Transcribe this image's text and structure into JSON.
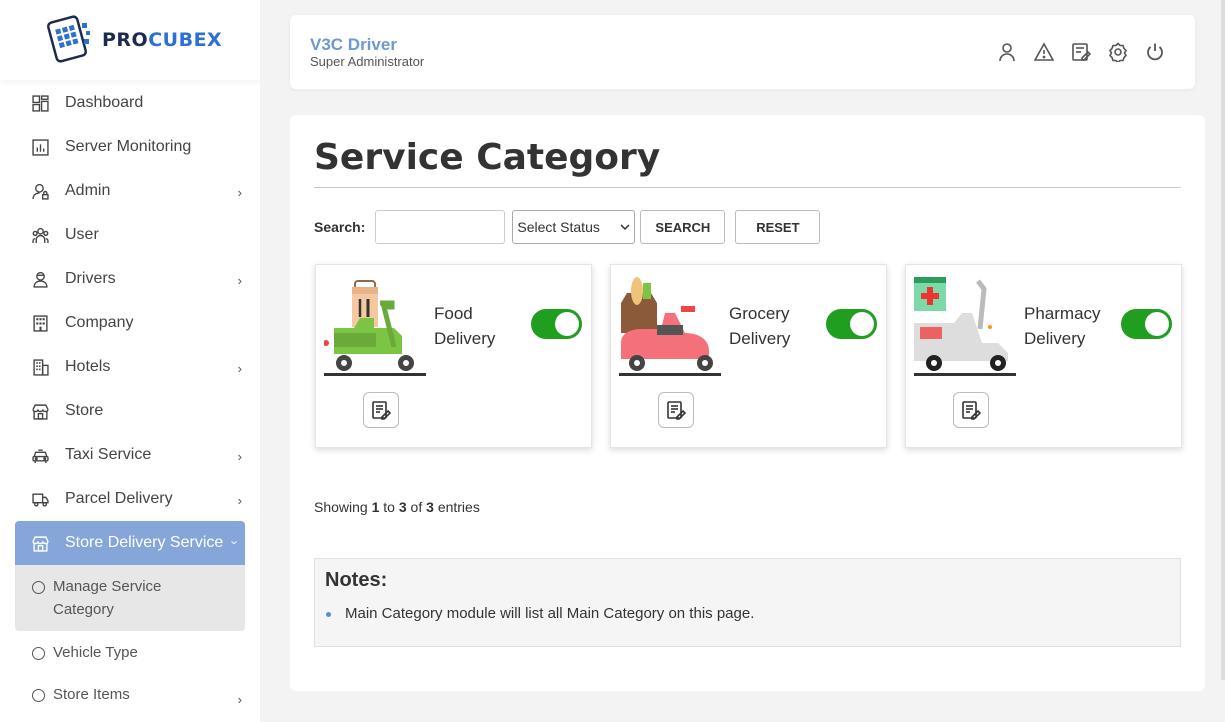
{
  "brand": {
    "logo_pro": "PRO",
    "logo_cubex": "CUBEX"
  },
  "sidebar": {
    "items": [
      {
        "label": "Dashboard",
        "icon": "dashboard-icon"
      },
      {
        "label": "Server Monitoring",
        "icon": "chart-icon"
      },
      {
        "label": "Admin",
        "icon": "admin-icon",
        "expandable": true
      },
      {
        "label": "User",
        "icon": "users-icon"
      },
      {
        "label": "Drivers",
        "icon": "driver-icon",
        "expandable": true
      },
      {
        "label": "Company",
        "icon": "building-icon"
      },
      {
        "label": "Hotels",
        "icon": "hotel-icon",
        "expandable": true
      },
      {
        "label": "Store",
        "icon": "store-icon"
      },
      {
        "label": "Taxi Service",
        "icon": "taxi-icon",
        "expandable": true
      },
      {
        "label": "Parcel Delivery",
        "icon": "truck-icon",
        "expandable": true
      },
      {
        "label": "Store Delivery Service",
        "icon": "store-icon",
        "expandable": true,
        "active": true
      }
    ],
    "subitems": [
      {
        "label": "Manage Service Category",
        "active": true
      },
      {
        "label": "Vehicle Type"
      },
      {
        "label": "Store Items",
        "expandable": true
      }
    ]
  },
  "header": {
    "title": "V3C Driver",
    "subtitle": "Super Administrator"
  },
  "page": {
    "title": "Service Category"
  },
  "search": {
    "label": "Search:",
    "value": "",
    "status_selected": "Select Status",
    "search_button": "SEARCH",
    "reset_button": "RESET"
  },
  "categories": [
    {
      "name": "Food Delivery",
      "enabled": true
    },
    {
      "name": "Grocery Delivery",
      "enabled": true
    },
    {
      "name": "Pharmacy Delivery",
      "enabled": true
    }
  ],
  "pagination": {
    "prefix": "Showing",
    "from": "1",
    "to_word": "to",
    "to": "3",
    "of_word": "of",
    "total": "3",
    "suffix": "entries"
  },
  "notes": {
    "title": "Notes:",
    "items": [
      "Main Category module will list all Main Category on this page."
    ]
  },
  "colors": {
    "accent": "#86a6da",
    "toggle_on": "#1f9e1f",
    "brand_blue": "#2d6fd3"
  }
}
